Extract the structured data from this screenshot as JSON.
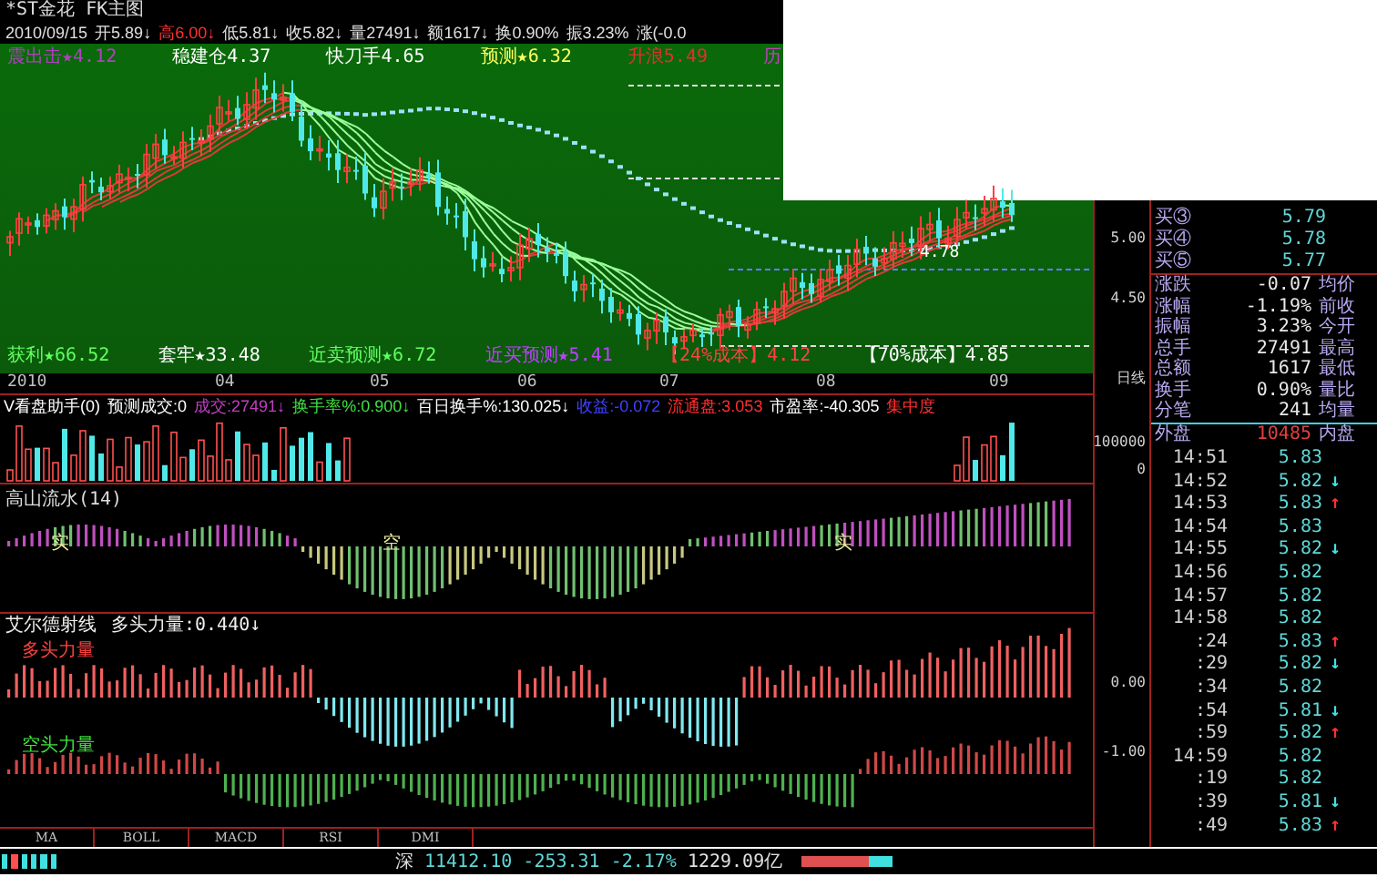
{
  "header": {
    "title": "*ST金花",
    "subtitle": "FK主图"
  },
  "quote": [
    {
      "text": "2010/09/15",
      "color": "#e0e0e0"
    },
    {
      "text": "开5.89↓",
      "color": "#e0e0e0"
    },
    {
      "text": "高6.00↓",
      "color": "#ff3030"
    },
    {
      "text": "低5.81↓",
      "color": "#e0e0e0"
    },
    {
      "text": "收5.82↓",
      "color": "#e0e0e0"
    },
    {
      "text": "量27491↓",
      "color": "#e0e0e0"
    },
    {
      "text": "额1617↓",
      "color": "#e0e0e0"
    },
    {
      "text": "换0.90%",
      "color": "#e0e0e0"
    },
    {
      "text": "振3.23%",
      "color": "#e0e0e0"
    },
    {
      "text": "涨(-0.0",
      "color": "#e0e0e0"
    }
  ],
  "main_chart": {
    "top_labels": [
      {
        "text": "震出击★4.12",
        "color": "#b040c0"
      },
      {
        "text": "稳建仓4.37",
        "color": "#ffffff"
      },
      {
        "text": "快刀手4.65",
        "color": "#ffffff"
      },
      {
        "text": "预测★6.32",
        "color": "#ffff60"
      },
      {
        "text": "升浪5.49",
        "color": "#e03030"
      },
      {
        "text": "历",
        "color": "#c040c0"
      }
    ],
    "bottom_labels": [
      {
        "text": "获利★66.52",
        "color": "#60ff60"
      },
      {
        "text": "套牢★33.48",
        "color": "#ffffff"
      },
      {
        "text": "近卖预测★6.72",
        "color": "#60ff60"
      },
      {
        "text": "近买预测★5.41",
        "color": "#c040ff"
      },
      {
        "text": "【24%成本】4.12",
        "color": "#ff4040"
      },
      {
        "text": "【70%成本】4.85",
        "color": "#ffffff"
      }
    ],
    "level_label": "4.78"
  },
  "date_axis": [
    "2010",
    "04",
    "05",
    "06",
    "07",
    "08",
    "09"
  ],
  "volume_header": [
    {
      "text": "V看盘助手(0)",
      "color": "#ffffff"
    },
    {
      "text": "预测成交:0",
      "color": "#ffffff"
    },
    {
      "text": "成交:27491↓",
      "color": "#c040c0"
    },
    {
      "text": "换手率%:0.900↓",
      "color": "#40e040"
    },
    {
      "text": "百日换手%:130.025↓",
      "color": "#ffffff"
    },
    {
      "text": "收益:-0.072",
      "color": "#4040ff"
    },
    {
      "text": "流通盘:3.053",
      "color": "#ff3030"
    },
    {
      "text": "市盈率:-40.305",
      "color": "#ffffff"
    },
    {
      "text": "集中度",
      "color": "#ff3030"
    }
  ],
  "trend_panel": {
    "title": "高山流水(14)",
    "marks": [
      "实",
      "空",
      "实"
    ]
  },
  "elder_panel": {
    "title": "艾尔德射线",
    "reading": "多头力量:0.440↓",
    "bull_label": "多头力量",
    "bear_label": "空头力量"
  },
  "axis_labels": [
    "5.00",
    "4.50",
    "日线",
    "100000",
    "0",
    "0.00",
    "-1.00"
  ],
  "bids": [
    {
      "label": "买③",
      "price": "5.79"
    },
    {
      "label": "买④",
      "price": "5.78"
    },
    {
      "label": "买⑤",
      "price": "5.77"
    }
  ],
  "stats": [
    {
      "label": "涨跌",
      "value": "-0.07",
      "label2": "均价"
    },
    {
      "label": "涨幅",
      "value": "-1.19%",
      "label2": "前收"
    },
    {
      "label": "振幅",
      "value": "3.23%",
      "label2": "今开"
    },
    {
      "label": "总手",
      "value": "27491",
      "label2": "最高"
    },
    {
      "label": "总额",
      "value": "1617",
      "label2": "最低"
    },
    {
      "label": "换手",
      "value": "0.90%",
      "label2": "量比"
    },
    {
      "label": "分笔",
      "value": "241",
      "label2": "均量"
    }
  ],
  "outer": {
    "label": "外盘",
    "value": "10485",
    "label2": "内盘"
  },
  "trades": [
    {
      "time": "14:51",
      "price": "5.83"
    },
    {
      "time": "14:52",
      "price": "5.82",
      "arrow": "↓",
      "color": "#40e0e0"
    },
    {
      "time": "14:53",
      "price": "5.83",
      "arrow": "↑",
      "color": "#ff3030"
    },
    {
      "time": "14:54",
      "price": "5.83"
    },
    {
      "time": "14:55",
      "price": "5.82",
      "arrow": "↓",
      "color": "#40e0e0"
    },
    {
      "time": "14:56",
      "price": "5.82"
    },
    {
      "time": "14:57",
      "price": "5.82"
    },
    {
      "time": "14:58",
      "price": "5.82"
    },
    {
      "time": ":24",
      "price": "5.83",
      "arrow": "↑",
      "color": "#ff3030"
    },
    {
      "time": ":29",
      "price": "5.82",
      "arrow": "↓",
      "color": "#40e0e0"
    },
    {
      "time": ":34",
      "price": "5.82"
    },
    {
      "time": ":54",
      "price": "5.81",
      "arrow": "↓",
      "color": "#40e0e0"
    },
    {
      "time": ":59",
      "price": "5.82",
      "arrow": "↑",
      "color": "#ff3030"
    },
    {
      "time": "14:59",
      "price": "5.82"
    },
    {
      "time": ":19",
      "price": "5.82"
    },
    {
      "time": ":39",
      "price": "5.81",
      "arrow": "↓",
      "color": "#40e0e0"
    },
    {
      "time": ":49",
      "price": "5.83",
      "arrow": "↑",
      "color": "#ff3030"
    }
  ],
  "tabs": [
    {
      "label": "MA",
      "selected": false
    },
    {
      "label": "BOLL",
      "selected": false
    },
    {
      "label": "MACD",
      "selected": false
    },
    {
      "label": "RSI",
      "selected": false
    },
    {
      "label": "DMI",
      "selected": false
    }
  ],
  "status_bar": {
    "market": "深",
    "index": "11412.10",
    "change": "-253.31",
    "percent": "-2.17%",
    "turnover": "1229.09亿"
  }
}
